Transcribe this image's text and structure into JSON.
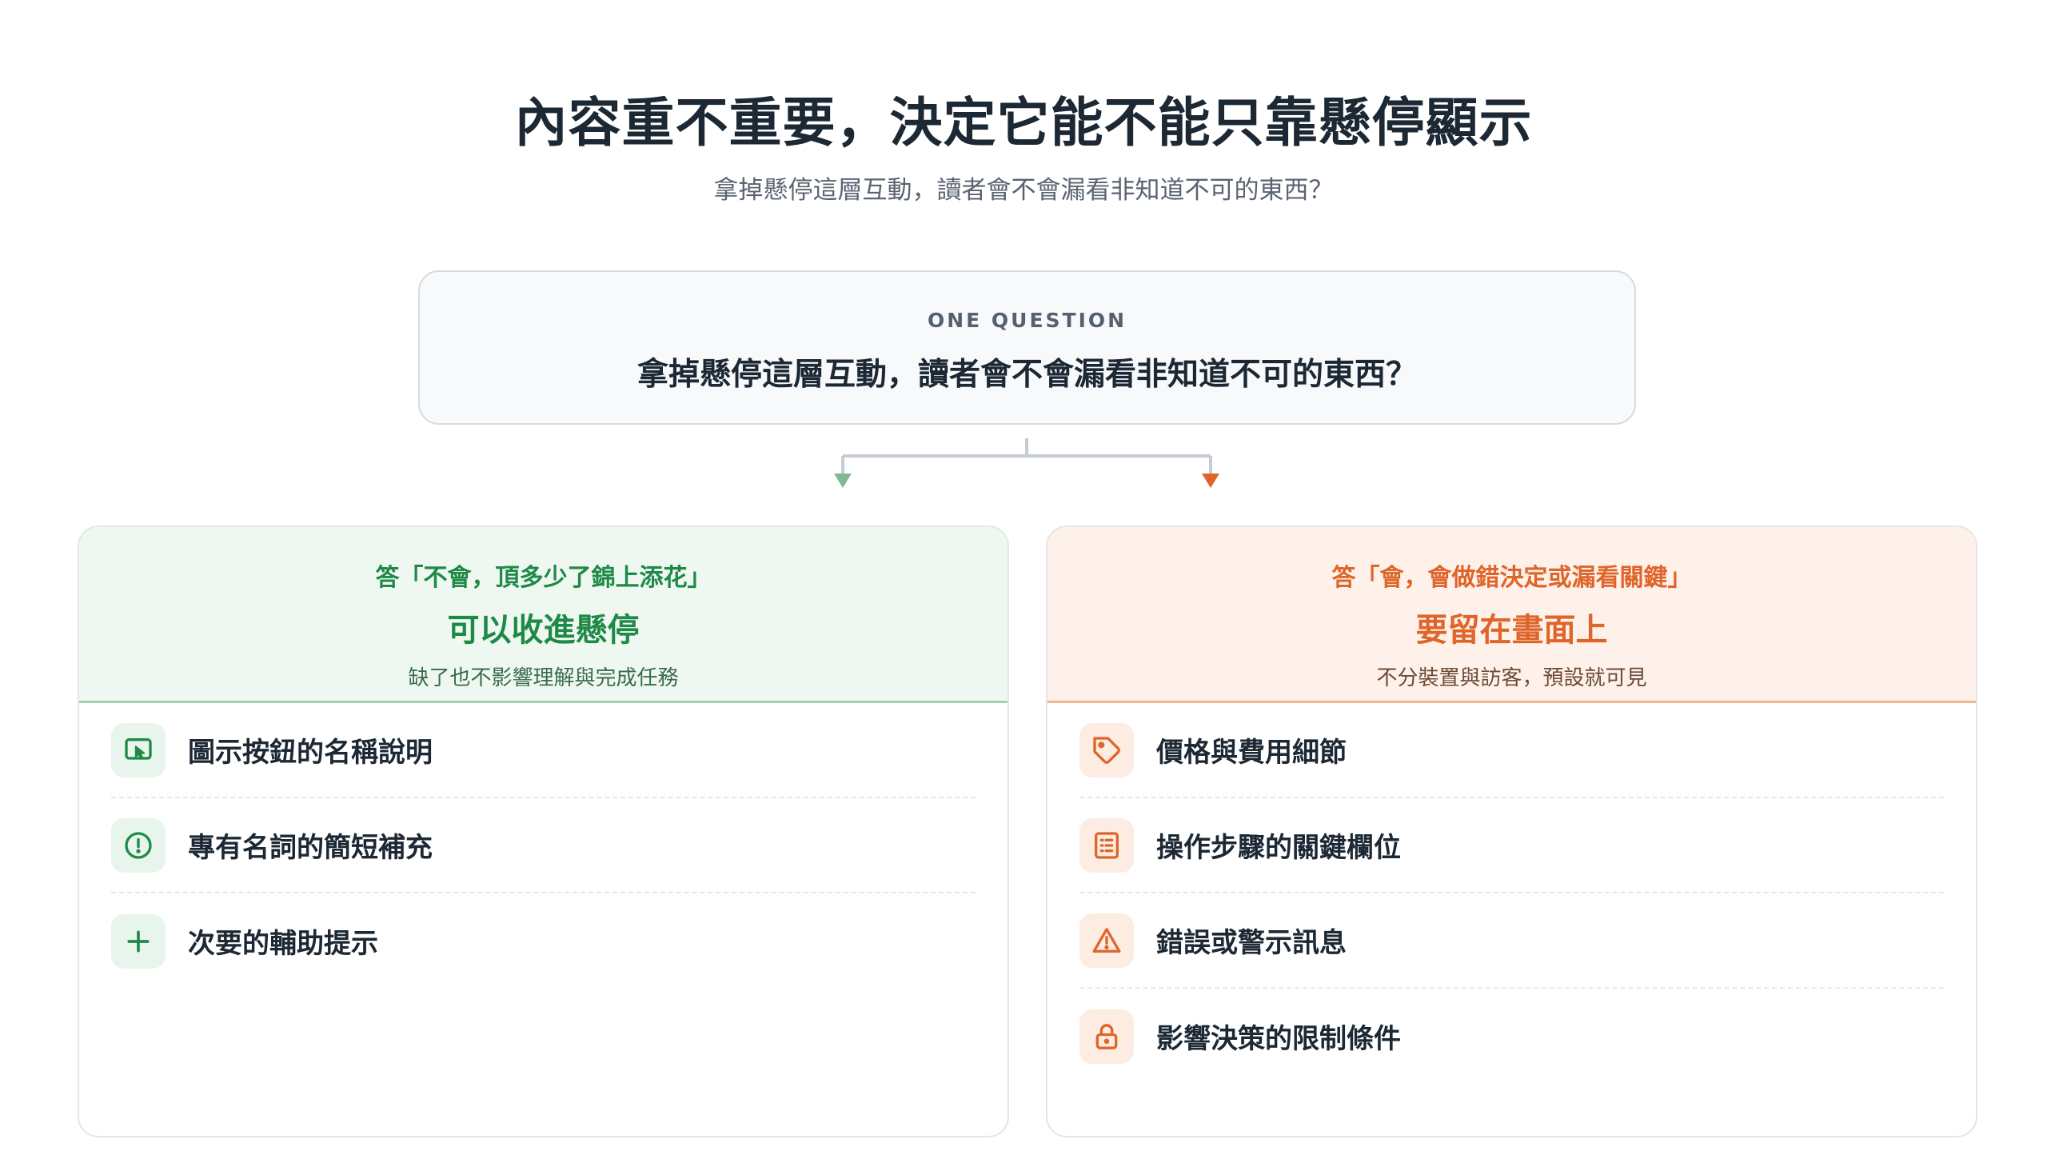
{
  "header": {
    "title": "內容重不重要，決定它能不能只靠懸停顯示",
    "subtitle": "拿掉懸停這層互動，讀者會不會漏看非知道不可的東西？"
  },
  "question": {
    "kicker": "ONE QUESTION",
    "text": "拿掉懸停這層互動，讀者會不會漏看非知道不可的東西？"
  },
  "colors": {
    "green": "#1f8a47",
    "orange": "#e0652a",
    "connector": "#c5ccd3"
  },
  "branches": [
    {
      "answer": "答「不會，頂多少了錦上添花」",
      "verdict": "可以收進懸停",
      "note": "缺了也不影響理解與完成任務",
      "items": [
        {
          "label": "圖示按鈕的名稱說明",
          "icon": "cursor-click-icon"
        },
        {
          "label": "專有名詞的簡短補充",
          "icon": "info-circle-icon"
        },
        {
          "label": "次要的輔助提示",
          "icon": "plus-icon"
        }
      ]
    },
    {
      "answer": "答「會，會做錯決定或漏看關鍵」",
      "verdict": "要留在畫面上",
      "note": "不分裝置與訪客，預設就可見",
      "items": [
        {
          "label": "價格與費用細節",
          "icon": "price-tag-icon"
        },
        {
          "label": "操作步驟的關鍵欄位",
          "icon": "form-list-icon"
        },
        {
          "label": "錯誤或警示訊息",
          "icon": "warning-triangle-icon"
        },
        {
          "label": "影響決策的限制條件",
          "icon": "lock-icon"
        }
      ]
    }
  ]
}
